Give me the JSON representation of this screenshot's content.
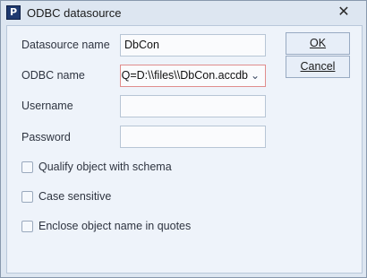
{
  "window": {
    "title": "ODBC datasource",
    "app_icon_letter": "P",
    "close_glyph": "✕"
  },
  "form": {
    "datasource_name_label": "Datasource name",
    "datasource_name_value": "DbCon",
    "odbc_name_label": "ODBC name",
    "odbc_name_value": "DBQ=D:\\\\files\\\\DbCon.accdb",
    "username_label": "Username",
    "username_value": "",
    "password_label": "Password",
    "password_value": ""
  },
  "buttons": {
    "ok_label": "OK",
    "cancel_label": "Cancel"
  },
  "options": [
    {
      "label": "Qualify object with schema",
      "checked": false
    },
    {
      "label": "Case sensitive",
      "checked": false
    },
    {
      "label": "Enclose object name in quotes",
      "checked": false
    }
  ],
  "icons": {
    "app": "app-logo-icon",
    "close": "close-icon",
    "dropdown": "chevron-down-icon"
  }
}
